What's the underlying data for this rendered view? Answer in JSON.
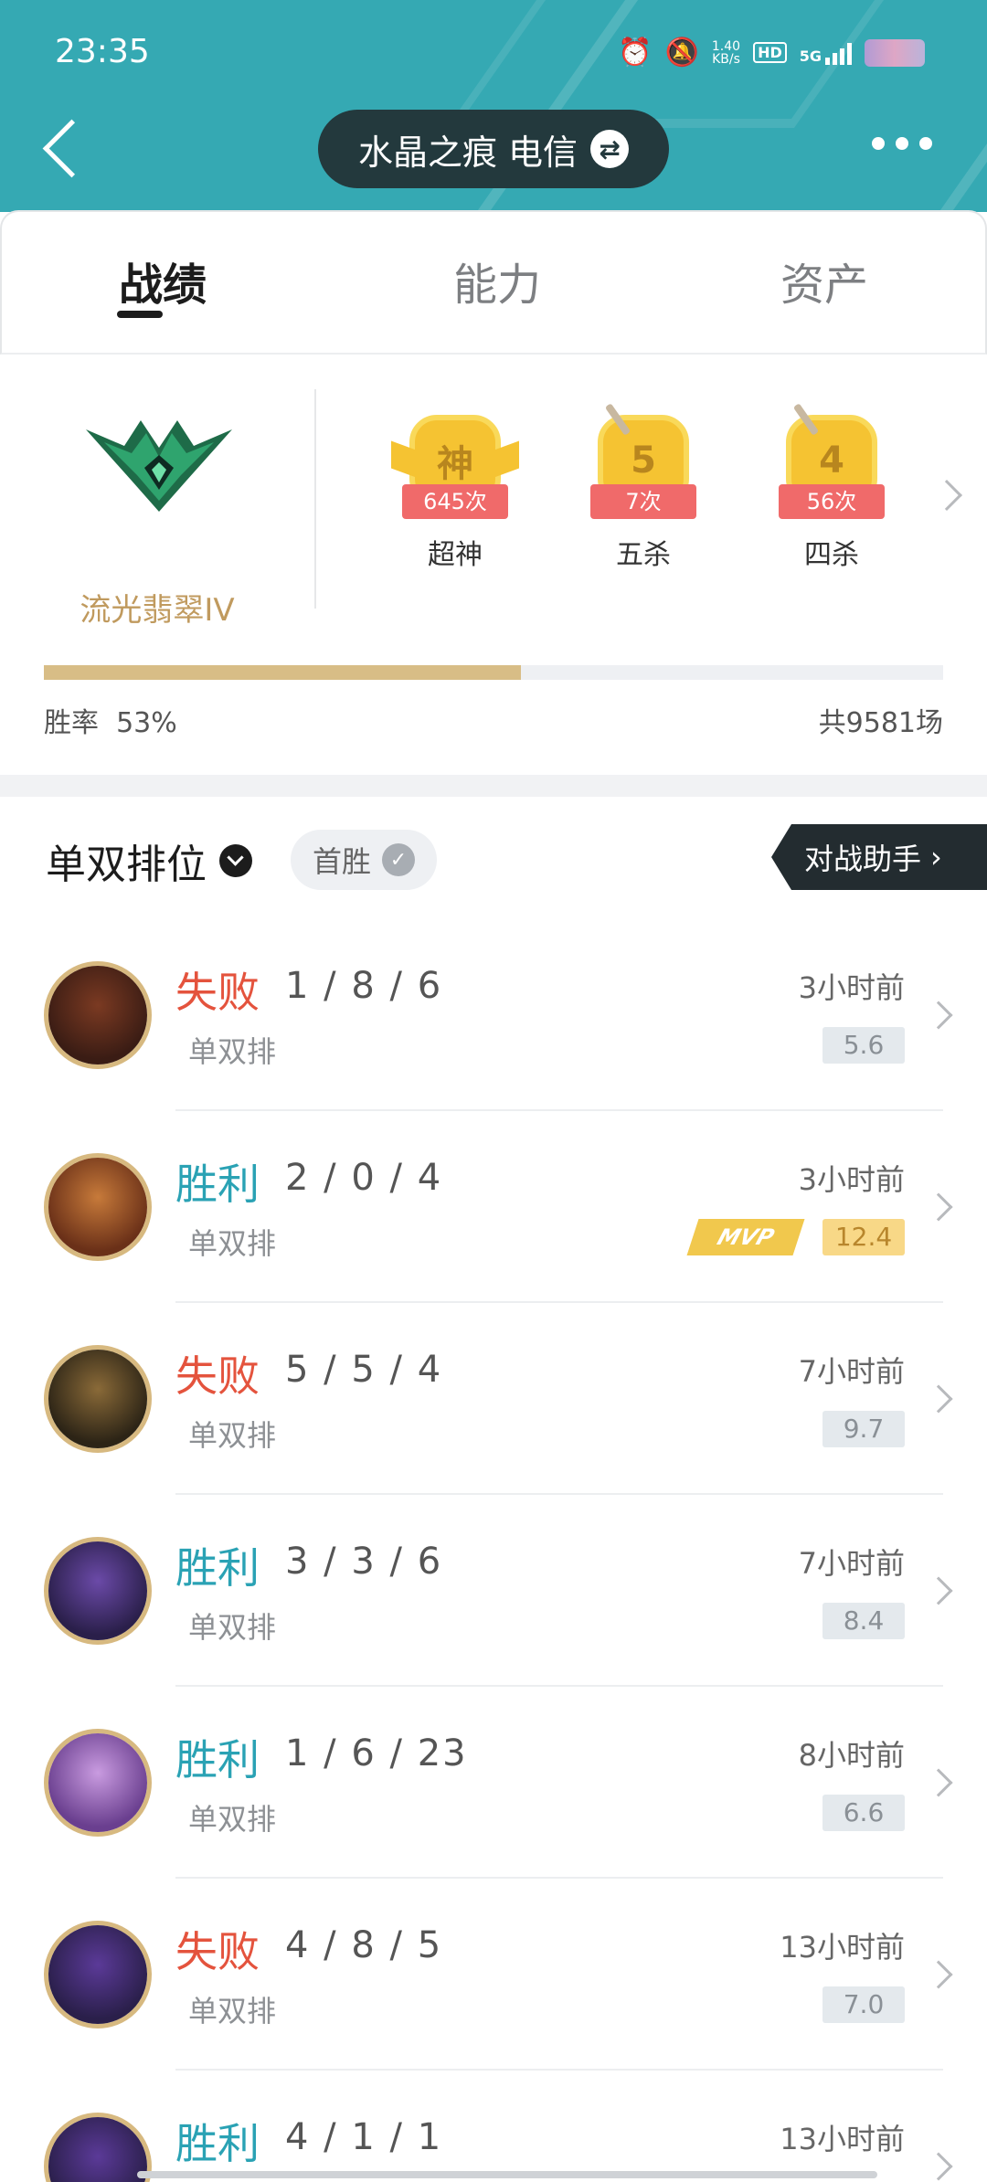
{
  "status_bar": {
    "time": "23:35",
    "net_speed_value": "1.40",
    "net_speed_unit": "KB/s",
    "hd": "HD",
    "network": "5G"
  },
  "header": {
    "server_name": "水晶之痕 电信",
    "swap_icon": "⇄"
  },
  "tabs": [
    {
      "label": "战绩",
      "active": true
    },
    {
      "label": "能力",
      "active": false
    },
    {
      "label": "资产",
      "active": false
    }
  ],
  "overview": {
    "rank_name": "流光翡翠IV",
    "badges": [
      {
        "glyph": "神",
        "count": "645次",
        "label": "超神",
        "icon": "legendary-wings-badge"
      },
      {
        "glyph": "5",
        "count": "7次",
        "label": "五杀",
        "icon": "penta-kill-badge"
      },
      {
        "glyph": "4",
        "count": "56次",
        "label": "四杀",
        "icon": "quadra-kill-badge"
      }
    ],
    "win_rate_label": "胜率",
    "win_rate_value": "53%",
    "win_rate_fraction": 0.53,
    "total_games": "共9581场"
  },
  "filter": {
    "queue_title": "单双排位",
    "first_win_label": "首胜",
    "assistant_label": "对战助手"
  },
  "matches": [
    {
      "result": "失败",
      "outcome": "loss",
      "kda": "1 / 8 / 6",
      "queue": "单双排",
      "ago": "3小时前",
      "score": "5.6",
      "mvp": false
    },
    {
      "result": "胜利",
      "outcome": "win",
      "kda": "2 / 0 / 4",
      "queue": "单双排",
      "ago": "3小时前",
      "score": "12.4",
      "mvp": true,
      "mvp_label": "MVP"
    },
    {
      "result": "失败",
      "outcome": "loss",
      "kda": "5 / 5 / 4",
      "queue": "单双排",
      "ago": "7小时前",
      "score": "9.7",
      "mvp": false
    },
    {
      "result": "胜利",
      "outcome": "win",
      "kda": "3 / 3 / 6",
      "queue": "单双排",
      "ago": "7小时前",
      "score": "8.4",
      "mvp": false
    },
    {
      "result": "胜利",
      "outcome": "win",
      "kda": "1 / 6 / 23",
      "queue": "单双排",
      "ago": "8小时前",
      "score": "6.6",
      "mvp": false
    },
    {
      "result": "失败",
      "outcome": "loss",
      "kda": "4 / 8 / 5",
      "queue": "单双排",
      "ago": "13小时前",
      "score": "7.0",
      "mvp": false
    },
    {
      "result": "胜利",
      "outcome": "win",
      "kda": "4 / 1 / 1",
      "queue": "",
      "ago": "13小时前",
      "score": "",
      "mvp": false
    }
  ],
  "colors": {
    "header_bg": "#35a9b3",
    "win": "#2aa2b4",
    "loss": "#e4533d",
    "rank_gold": "#c09a5e",
    "progress_fill": "#d8bd86"
  }
}
